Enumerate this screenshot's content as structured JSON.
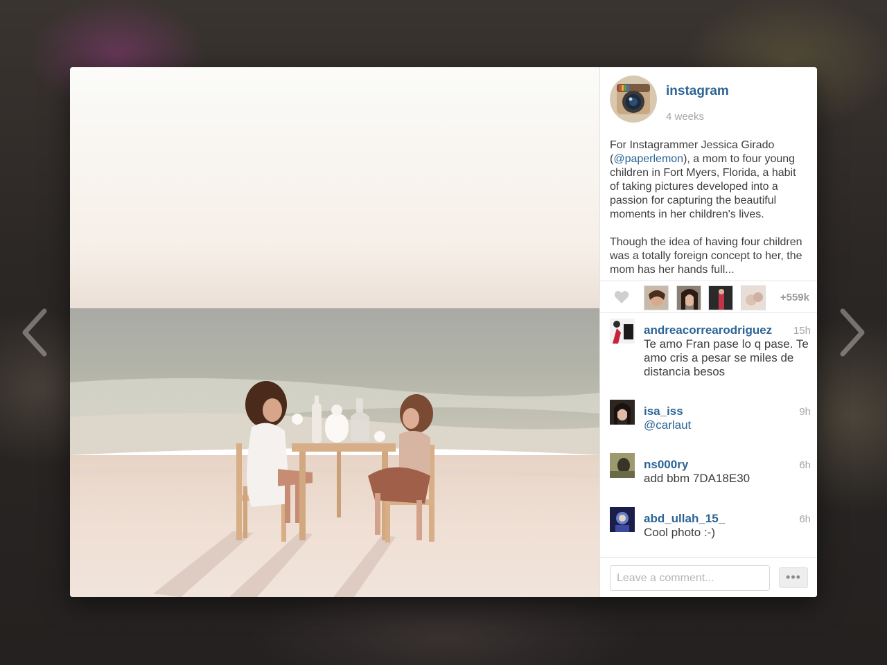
{
  "post": {
    "username": "instagram",
    "time_ago": "4 weeks",
    "caption_para1_before": "For Instagrammer Jessica Girado (",
    "caption_mention": "@paperlemon",
    "caption_para1_after": "), a mom to four young children in Fort Myers, Florida, a habit of taking pictures developed into a passion for capturing the beautiful moments in her children's lives.",
    "caption_para2": "Though the idea of having four children was a totally foreign concept to her, the mom has her hands full..."
  },
  "likes": {
    "count_label": "+559k",
    "liker_icons": [
      "liker-avatar-1",
      "liker-avatar-2",
      "liker-avatar-3",
      "liker-avatar-4"
    ]
  },
  "comments": [
    {
      "user": "andreacorrearodriguez",
      "time": "15h",
      "text": "Te amo Fran pase lo q pase. Te amo cris a pesar se miles de distancia besos"
    },
    {
      "user": "isa_iss",
      "time": "9h",
      "text": "@carlaut"
    },
    {
      "user": "ns000ry",
      "time": "6h",
      "text": "add bbm 7DA18E30"
    },
    {
      "user": "abd_ullah_15_",
      "time": "6h",
      "text": "Cool photo :-)"
    }
  ],
  "comment_box": {
    "placeholder": "Leave a comment...",
    "more_label": "•••"
  },
  "icons": {
    "prev": "chevron-left-icon",
    "next": "chevron-right-icon",
    "like": "heart-icon",
    "accent": "#2b6496"
  }
}
